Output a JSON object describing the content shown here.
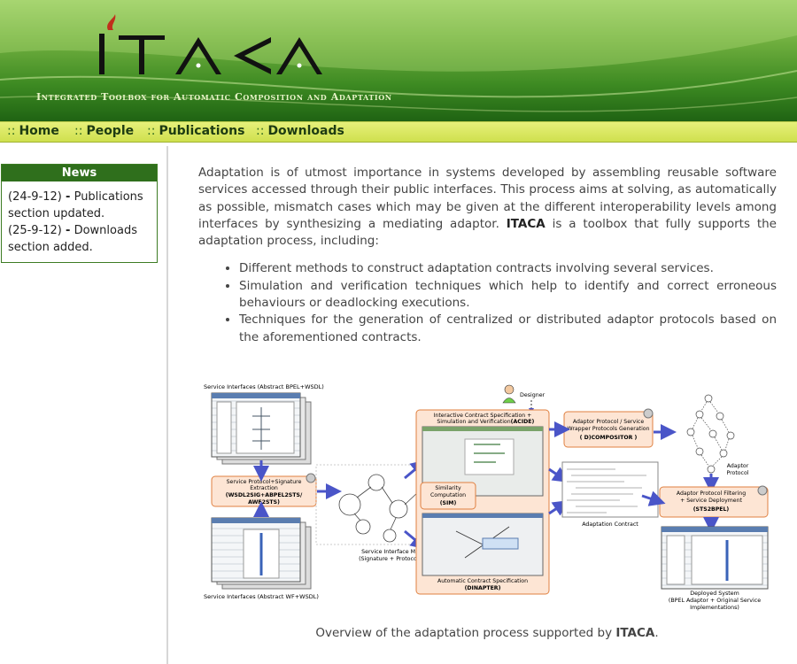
{
  "header": {
    "logo_text": "ITACA",
    "subtitle": "Integrated Toolbox for Automatic Composition and Adaptation"
  },
  "nav": {
    "separator": "::",
    "items": [
      {
        "label": "Home"
      },
      {
        "label": "People"
      },
      {
        "label": "Publications"
      },
      {
        "label": "Downloads"
      }
    ]
  },
  "news": {
    "title": "News",
    "items": [
      {
        "date": "(24-9-12)",
        "sep": "-",
        "text": "Publications section updated."
      },
      {
        "date": "(25-9-12)",
        "sep": "-",
        "text": "Downloads section added."
      }
    ]
  },
  "content": {
    "intro_before": "Adaptation is of utmost importance in systems developed by assembling reusable software services accessed through their public interfaces. This process aims at solving, as automatically as possible, mismatch cases which may be given at the different interoperability levels among interfaces by synthesizing a mediating adaptor. ",
    "intro_bold": "ITACA",
    "intro_after": " is a toolbox that fully supports the adaptation process, including:",
    "bullets": [
      "Different methods to construct adaptation contracts involving several services.",
      "Simulation and verification techniques which help to identify and correct erroneous behaviours or deadlocking executions.",
      "Techniques for the generation of centralized or distributed adaptor protocols based on the aforementioned contracts."
    ],
    "caption_before": "Overview of the adaptation process supported by ",
    "caption_bold": "ITACA",
    "caption_after": "."
  },
  "diagram": {
    "labels": {
      "service_interfaces_top": "Service Interfaces (Abstract BPEL+WSDL)",
      "designer": "Designer",
      "interactive_spec_1": "Interactive Contract Specification +",
      "interactive_spec_2": "Simulation and Verification",
      "interactive_spec_tool": "(ACIDE)",
      "adaptor_gen_1": "Adaptor Protocol / Service",
      "adaptor_gen_2": "Wrapper Protocols Generation",
      "adaptor_gen_tool": "( D)COMPOSITOR )",
      "extraction_1": "Service Protocol+Signature",
      "extraction_2": "Extraction",
      "extraction_tool_1": "(WSDL2SIG+ABPEL2STS/",
      "extraction_tool_2": "AWF2STS)",
      "similarity_1": "Similarity",
      "similarity_2": "Computation",
      "similarity_tool": "(SIM)",
      "adaptor_protocol_1": "Adaptor",
      "adaptor_protocol_2": "Protocol",
      "filtering_1": "Adaptor Protocol Filtering",
      "filtering_2": "+ Service Deployment",
      "filtering_tool": "(STS2BPEL)",
      "adaptation_contract": "Adaptation Contract",
      "sim_models_1": "Service Interface Models",
      "sim_models_2": "(Signature + Protocol STS)",
      "auto_contract_1": "Automatic Contract Specification",
      "auto_contract_tool": "(DINAPTER)",
      "service_interfaces_bottom": "Service Interfaces (Abstract WF+WSDL)",
      "deployed_1": "Deployed System",
      "deployed_2": "(BPEL Adaptor + Original Service",
      "deployed_3": "Implementations)"
    },
    "colors": {
      "box_fill": "#fde5d4",
      "box_border": "#e08040",
      "arrow": "#4a55c8",
      "title_text": "#000000"
    }
  },
  "colors": {
    "header_dark": "#1f6313",
    "header_light": "#9fd06a",
    "nav_bg": "#d8e85c",
    "news_header": "#2f6f1c",
    "text": "#444444"
  }
}
